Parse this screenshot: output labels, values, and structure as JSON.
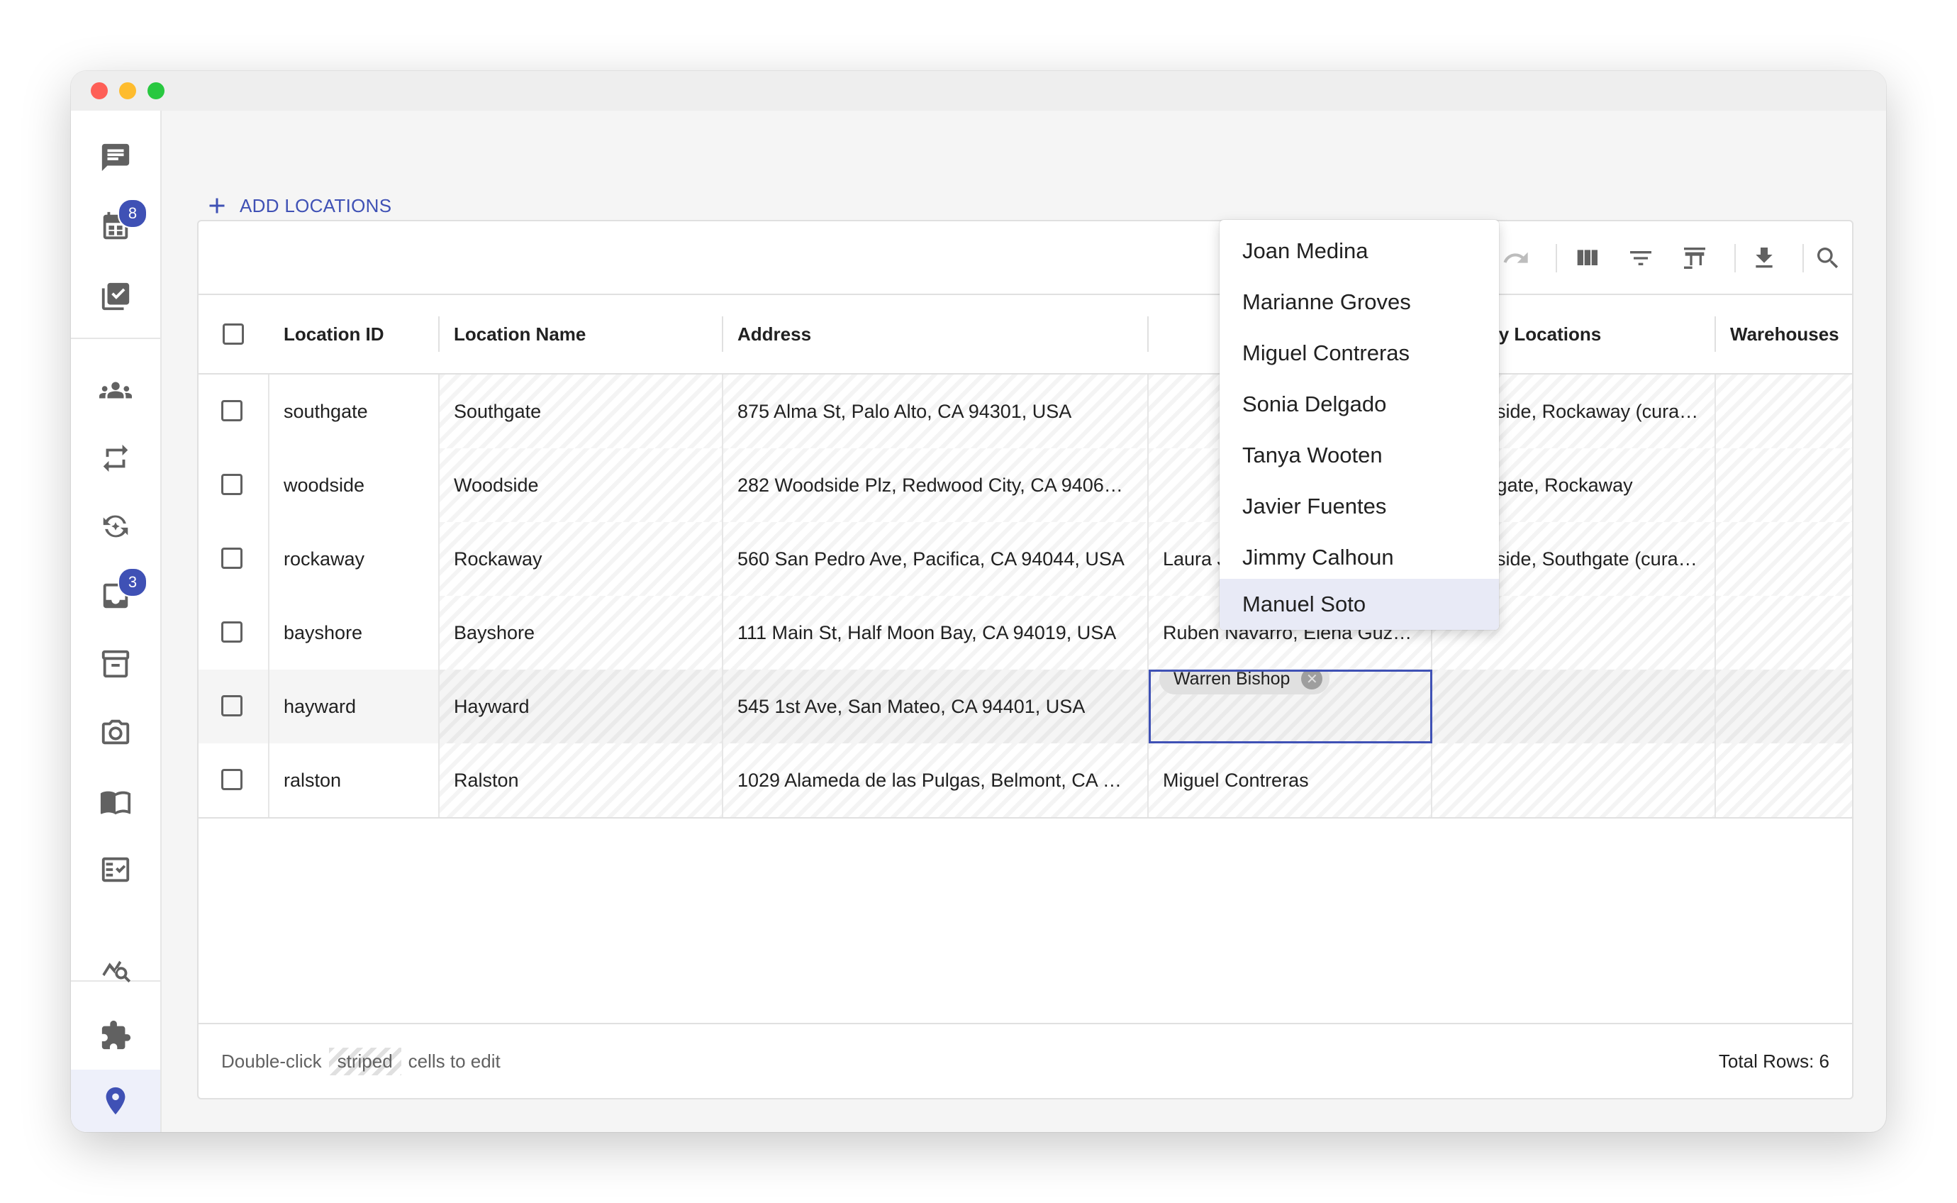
{
  "sidebar": {
    "badges": {
      "calendar": "8",
      "inbox": "3"
    }
  },
  "toolbar": {
    "add_label": "ADD LOCATIONS"
  },
  "grid": {
    "columns": [
      "Location ID",
      "Location Name",
      "Address",
      "",
      "Nearby Locations",
      "Warehouses"
    ],
    "rows": [
      {
        "id": "southgate",
        "name": "Southgate",
        "address": "875 Alma St, Palo Alto, CA 94301, USA",
        "people": "",
        "nearby": "Woodside, Rockaway (cura…",
        "warehouses": ""
      },
      {
        "id": "woodside",
        "name": "Woodside",
        "address": "282 Woodside Plz, Redwood City, CA 9406…",
        "people": "",
        "nearby": "Southgate, Rockaway",
        "warehouses": ""
      },
      {
        "id": "rockaway",
        "name": "Rockaway",
        "address": "560 San Pedro Ave, Pacifica, CA 94044, USA",
        "people": "Laura Jenkins, Nicole Zara…",
        "nearby": "Woodside, Southgate (cura…",
        "warehouses": ""
      },
      {
        "id": "bayshore",
        "name": "Bayshore",
        "address": "111 Main St, Half Moon Bay, CA 94019, USA",
        "people": "Ruben Navarro, Elena Guz…",
        "nearby": "",
        "warehouses": ""
      },
      {
        "id": "hayward",
        "name": "Hayward",
        "address": "545 1st Ave, San Mateo, CA 94401, USA",
        "people": "",
        "nearby": "",
        "warehouses": ""
      },
      {
        "id": "ralston",
        "name": "Ralston",
        "address": "1029 Alameda de las Pulgas, Belmont, CA …",
        "people": "Miguel Contreras",
        "nearby": "",
        "warehouses": ""
      }
    ],
    "editing_chip": "Warren Bishop"
  },
  "dropdown": {
    "options": [
      "Joan Medina",
      "Marianne Groves",
      "Miguel Contreras",
      "Sonia Delgado",
      "Tanya Wooten",
      "Javier Fuentes",
      "Jimmy Calhoun",
      "Manuel Soto"
    ],
    "selected": "Manuel Soto"
  },
  "footer": {
    "hint_before": "Double-click",
    "hint_striped": "striped",
    "hint_after": "cells to edit",
    "total_rows": "Total Rows: 6"
  },
  "colors": {
    "accent": "#3f51b5",
    "selected_option": "#e8eaf6"
  }
}
